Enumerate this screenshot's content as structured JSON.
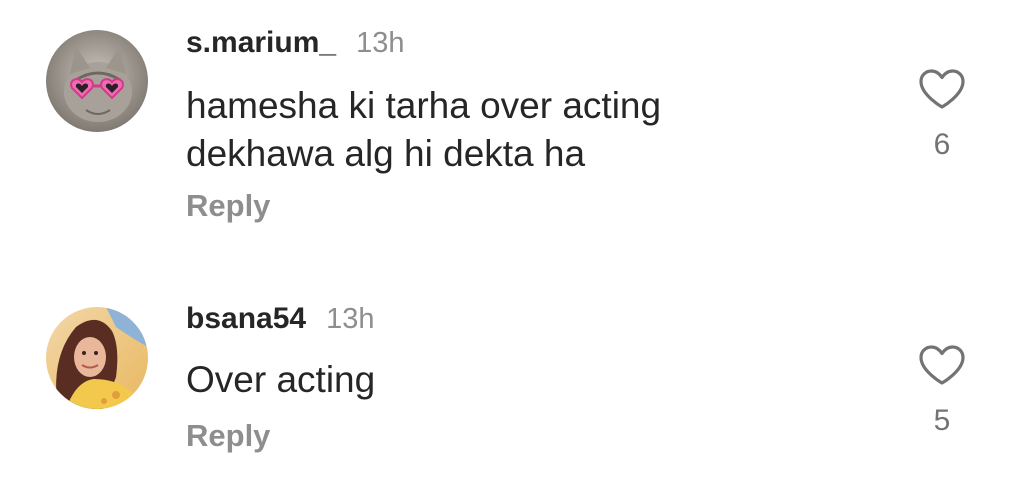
{
  "comments": [
    {
      "username": "s.marium_",
      "time": "13h",
      "text_lines": [
        "hamesha ki tarha over acting",
        "dekhawa alg hi dekta ha"
      ],
      "reply_label": "Reply",
      "likes": "6",
      "like_icon": "heart-outline-icon",
      "avatar_icon": "cat-with-heart-sunglasses-avatar"
    },
    {
      "username": "bsana54",
      "time": "13h",
      "text_lines": [
        "Over acting"
      ],
      "reply_label": "Reply",
      "likes": "5",
      "like_icon": "heart-outline-icon",
      "avatar_icon": "woman-portrait-avatar"
    }
  ],
  "colors": {
    "text_primary": "#262626",
    "text_secondary": "#8e8e8e",
    "background": "#ffffff"
  }
}
